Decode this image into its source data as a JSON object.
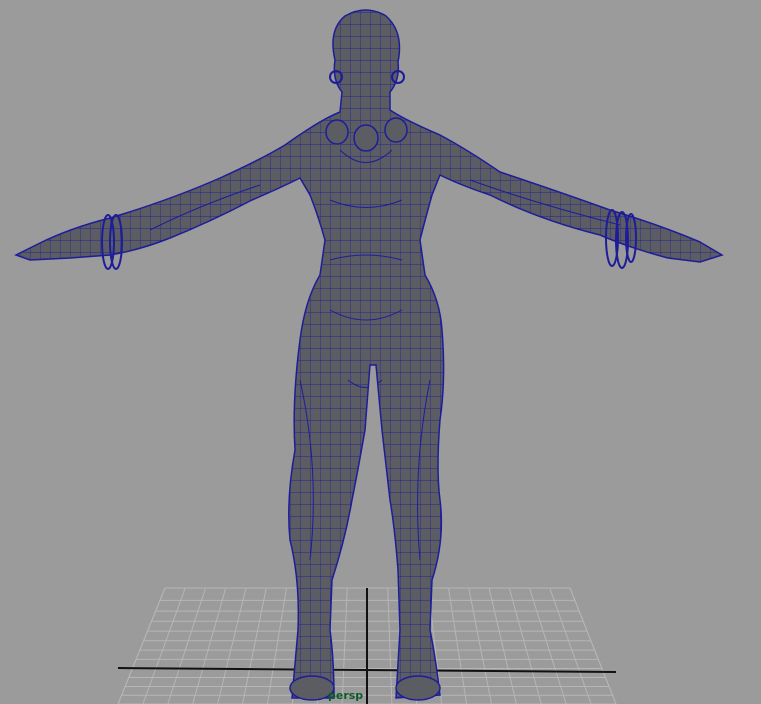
{
  "viewport": {
    "camera_label": "persp",
    "background_color": "#9b9b9b",
    "label_color": "#0e5a2a",
    "grid_color": "#b6b6b6",
    "axis_color": "#111111",
    "wire_color": "#1d1d9a",
    "mesh_fill_color": "#5c5c63",
    "object_icon": "wireframe-humanoid-mesh-icon"
  }
}
